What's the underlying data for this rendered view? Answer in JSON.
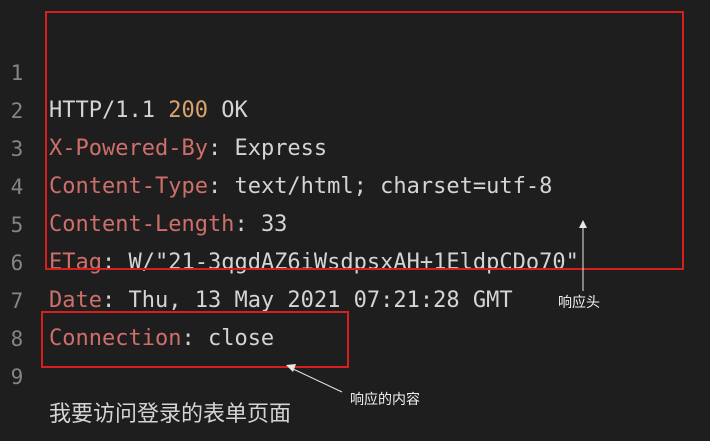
{
  "editor": {
    "lines": [
      {
        "num": "1",
        "parts": [
          {
            "t": "HTTP/1.1 ",
            "c": "val"
          },
          {
            "t": "200",
            "c": "status"
          },
          {
            "t": " OK",
            "c": "val"
          }
        ]
      },
      {
        "num": "2",
        "parts": [
          {
            "t": "X-Powered-By",
            "c": "key"
          },
          {
            "t": ": ",
            "c": "sep"
          },
          {
            "t": "Express",
            "c": "val"
          }
        ]
      },
      {
        "num": "3",
        "parts": [
          {
            "t": "Content-Type",
            "c": "key"
          },
          {
            "t": ": ",
            "c": "sep"
          },
          {
            "t": "text/html; charset=utf-8",
            "c": "val"
          }
        ]
      },
      {
        "num": "4",
        "parts": [
          {
            "t": "Content-Length",
            "c": "key"
          },
          {
            "t": ": ",
            "c": "sep"
          },
          {
            "t": "33",
            "c": "val"
          }
        ]
      },
      {
        "num": "5",
        "parts": [
          {
            "t": "ETag",
            "c": "key"
          },
          {
            "t": ": ",
            "c": "sep"
          },
          {
            "t": "W/\"21-3qgdAZ6iWsdpsxAH+1EldpCDo70\"",
            "c": "val"
          }
        ]
      },
      {
        "num": "6",
        "parts": [
          {
            "t": "Date",
            "c": "key"
          },
          {
            "t": ": ",
            "c": "sep"
          },
          {
            "t": "Thu, 13 May 2021 07:21:28 GMT",
            "c": "val"
          }
        ]
      },
      {
        "num": "7",
        "parts": [
          {
            "t": "Connection",
            "c": "key"
          },
          {
            "t": ": ",
            "c": "sep"
          },
          {
            "t": "close",
            "c": "val"
          }
        ]
      },
      {
        "num": "8",
        "parts": []
      },
      {
        "num": "9",
        "parts": [
          {
            "t": "我要访问登录的表单页面",
            "c": "content-text"
          }
        ]
      }
    ]
  },
  "annotations": {
    "headers_label": "响应头",
    "body_label": "响应的内容"
  },
  "colors": {
    "background": "#1e1e1e",
    "line_number": "#858585",
    "header_key": "#ce6f6b",
    "status_code": "#d9a46c",
    "text": "#d4d4d4",
    "box_border": "#d61f1f",
    "annotation_text": "#f0f0f0"
  }
}
